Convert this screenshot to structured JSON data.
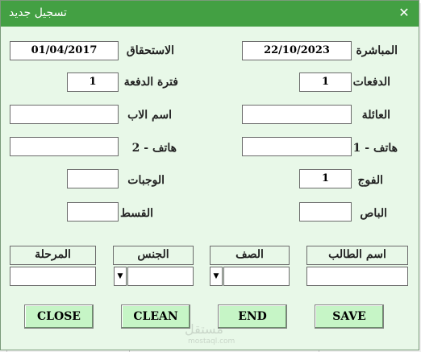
{
  "window": {
    "title": "تسجيل جديد",
    "close_glyph": "✕"
  },
  "fields": {
    "start_label": "المباشرة",
    "start_value": "22/10/2023",
    "due_label": "الاستحقاق",
    "due_value": "01/04/2017",
    "payments_label": "الدفعات",
    "payments_value": "1",
    "period_label": "فترة الدفعة",
    "period_value": "1",
    "family_label": "العائلة",
    "family_value": "",
    "father_label": "اسم الاب",
    "father_value": "",
    "phone1_label": "هاتف - 1",
    "phone1_value": "",
    "phone2_label": "هاتف - 2",
    "phone2_value": "",
    "group_label": "الفوج",
    "group_value": "1",
    "meals_label": "الوجبات",
    "meals_value": "",
    "bus_label": "الباص",
    "bus_value": "",
    "installment_label": "القسط",
    "installment_value": ""
  },
  "student": {
    "name_header": "اسم الطالب",
    "name_value": "",
    "class_header": "الصف",
    "class_value": "",
    "gender_header": "الجنس",
    "gender_value": "",
    "stage_header": "المرحلة",
    "stage_value": "",
    "dropdown_glyph": "▼"
  },
  "buttons": {
    "save": "SAVE",
    "end": "END",
    "clean": "CLEAN",
    "close": "CLOSE"
  },
  "watermark": {
    "text": "مستقل",
    "sub": "mostaql.com"
  },
  "colors": {
    "titlebar": "#43a043",
    "window_bg": "#e8f8e8",
    "button_bg": "#c6f5c6"
  }
}
